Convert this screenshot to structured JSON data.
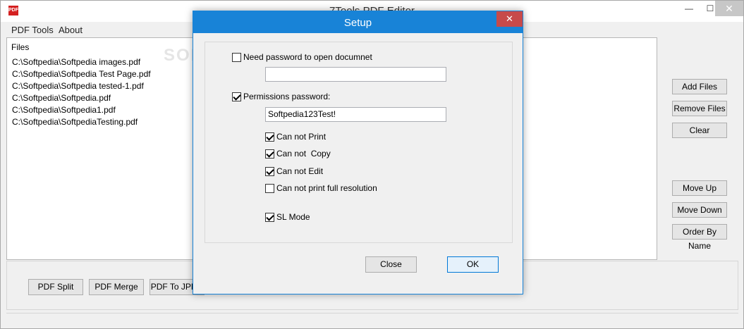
{
  "window": {
    "title": "7Tools PDF Editor",
    "icon_label": "PDF",
    "controls": {
      "minimize": "—",
      "maximize": "☐",
      "close": "✕"
    }
  },
  "menu": [
    "PDF Tools",
    "About"
  ],
  "files": {
    "header": "Files",
    "items": [
      "C:\\Softpedia\\Softpedia images.pdf",
      "C:\\Softpedia\\Softpedia Test Page.pdf",
      "C:\\Softpedia\\Softpedia tested-1.pdf",
      "C:\\Softpedia\\Softpedia.pdf",
      "C:\\Softpedia\\Softpedia1.pdf",
      "C:\\Softpedia\\SoftpediaTesting.pdf"
    ]
  },
  "side_buttons": {
    "add_files": "Add Files",
    "remove_files": "Remove Files",
    "clear": "Clear",
    "move_up": "Move Up",
    "move_down": "Move Down",
    "order_by_name": "Order By Name"
  },
  "bottom_buttons": {
    "split": "PDF Split",
    "merge": "PDF Merge",
    "to_jpeg": "PDF To JPEG"
  },
  "watermark": "SOFTPEDIA",
  "dialog": {
    "title": "Setup",
    "close_glyph": "✕",
    "need_password": {
      "label": "Need password to open documnet",
      "checked": false,
      "value": ""
    },
    "permissions_password": {
      "label": "Permissions password:",
      "checked": true,
      "value": "Softpedia123Test!"
    },
    "options": [
      {
        "label": "Can not Print",
        "checked": true
      },
      {
        "label": "Can not  Copy",
        "checked": true
      },
      {
        "label": "Can not Edit",
        "checked": true
      },
      {
        "label": "Can not print full resolution",
        "checked": false
      }
    ],
    "sl_mode": {
      "label": "SL Mode",
      "checked": true
    },
    "buttons": {
      "close": "Close",
      "ok": "OK"
    }
  },
  "colors": {
    "dialog_accent": "#1883d7",
    "close_red": "#c74a4a"
  }
}
